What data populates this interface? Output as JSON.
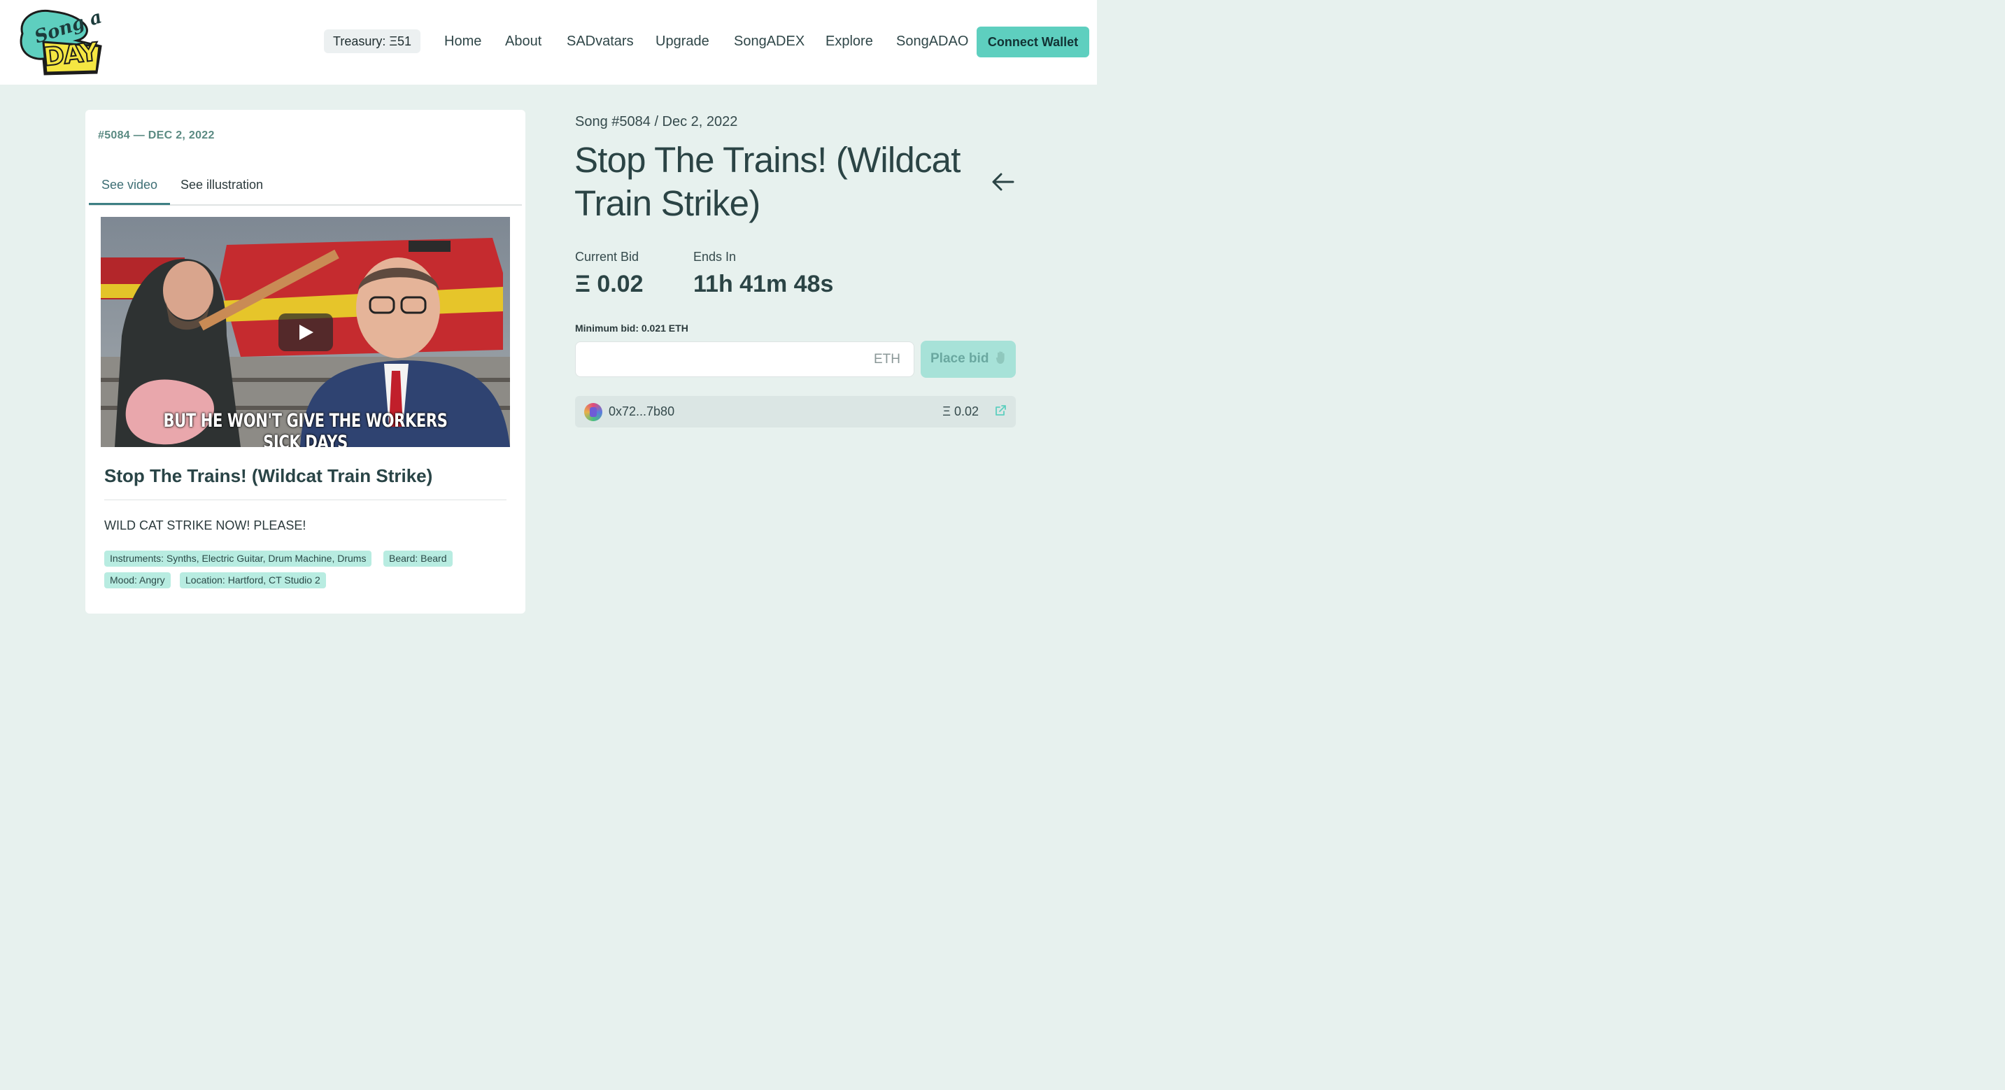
{
  "header": {
    "logo_song": "Song a",
    "logo_day": "DAY",
    "treasury": "Treasury: Ξ51",
    "nav": [
      "Home",
      "About",
      "SADvatars",
      "Upgrade",
      "SongADEX",
      "Explore",
      "SongADAO"
    ],
    "connect_wallet": "Connect Wallet",
    "colors": {
      "accent": "#5ecfbf",
      "background": "#e7f1ee"
    }
  },
  "card": {
    "meta": "#5084 — DEC 2, 2022",
    "tabs": [
      "See video",
      "See illustration"
    ],
    "active_tab": "See video",
    "video": {
      "caption": "But he won't give the workers sick days",
      "play_icon": "play-icon"
    },
    "title": "Stop The Trains! (Wildcat Train Strike)",
    "description": "WILD CAT STRIKE NOW! PLEASE!",
    "tags": [
      "Instruments: Synths, Electric Guitar, Drum Machine, Drums",
      "Beard: Beard",
      "Mood: Angry",
      "Location: Hartford, CT Studio 2"
    ]
  },
  "auction": {
    "meta": "Song #5084 / Dec 2, 2022",
    "title": "Stop The Trains! (Wildcat Train Strike)",
    "current_bid_label": "Current Bid",
    "current_bid_value": "Ξ 0.02",
    "ends_in_label": "Ends In",
    "ends_in_value": "11h 41m 48s",
    "min_bid": "Minimum bid: 0.021 ETH",
    "input_value": "",
    "input_suffix": "ETH",
    "place_bid": "Place bid",
    "bids": [
      {
        "bidder": "0x72...7b80",
        "amount": "Ξ 0.02"
      }
    ]
  }
}
